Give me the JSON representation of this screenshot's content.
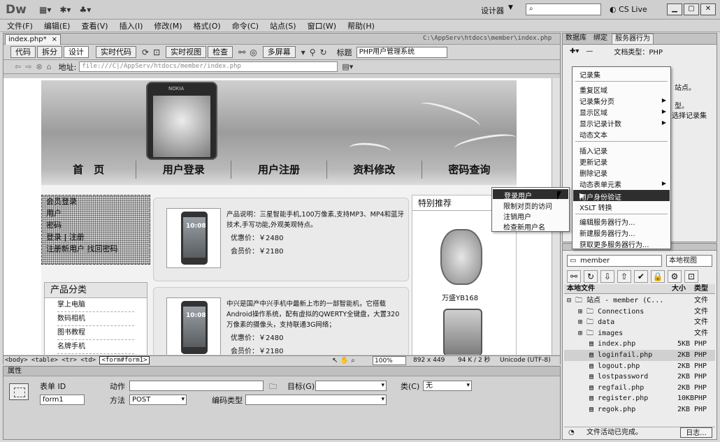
{
  "app": {
    "logo": "Dw",
    "workspace": "设计器",
    "cslive": "CS Live"
  },
  "menu": [
    "文件(F)",
    "编辑(E)",
    "查看(V)",
    "插入(I)",
    "修改(M)",
    "格式(O)",
    "命令(C)",
    "站点(S)",
    "窗口(W)",
    "帮助(H)"
  ],
  "doc": {
    "tab": "index.php*",
    "path": "C:\\AppServ\\htdocs\\member\\index.php",
    "views": [
      "代码",
      "拆分",
      "设计"
    ],
    "live_code": "实时代码",
    "live_view": "实时视图",
    "inspect": "检查",
    "multiscreen": "多屏幕",
    "title_label": "标题",
    "title_value": "PHP用户管理系统",
    "addr_label": "地址:",
    "addr_value": "file:///C|/AppServ/htdocs/member/index.php"
  },
  "page": {
    "phone_brand": "NOKIA",
    "nav": [
      "首　页",
      "用户登录",
      "用户注册",
      "资料修改",
      "密码查询"
    ],
    "left_dotted": [
      "会员登录",
      "用户",
      "密码",
      "登录 | 注册",
      "注册新用户 找回密码"
    ],
    "category_title": "产品分类",
    "categories": [
      "掌上电脑",
      "数码相机",
      "图书教程",
      "名牌手机"
    ],
    "products": [
      {
        "screen": "10:08",
        "text": "产品说明：三星智能手机,100万像素,支持MP3、MP4和蓝牙技术,手写功能,外观美观特点。",
        "price1": "优惠价：￥2480",
        "price2": "会员价：￥2180"
      },
      {
        "screen": "10:08",
        "text": "中兴是国产中兴手机中最新上市的一部智能机，它搭载Android操作系统，配有虚拟的QWERTY全键盘，大置320万像素的摄像头，支持联通3G网络；",
        "price1": "优惠价：￥2480",
        "price2": "会员价：￥2180"
      }
    ],
    "featured_title": "特别推荐",
    "featured_name": "万盛YB168"
  },
  "status": {
    "tags": "<body> <table> <tr> <td> ",
    "tag_selected": "<form#form1>",
    "zoom": "100%",
    "dims": "892 x 449",
    "size": "94 K / 2 秒",
    "encoding": "Unicode (UTF-8)"
  },
  "props": {
    "title": "属性",
    "form_id_label": "表单 ID",
    "form_id": "form1",
    "action_label": "动作",
    "method_label": "方法",
    "method_value": "POST",
    "enctype_label": "编码类型",
    "target_label": "目标(G)",
    "class_label": "类(C)",
    "class_value": "无"
  },
  "server_panel": {
    "tabs": [
      "数据库",
      "绑定",
      "服务器行为"
    ],
    "doctype": "文档类型：PHP",
    "bg_lines": [
      "站点。",
      "型。",
      "选择记录集"
    ]
  },
  "context_menu": {
    "items": [
      "记录集",
      "重复区域",
      "记录集分页",
      "显示区域",
      "显示记录计数",
      "动态文本",
      "插入记录",
      "更新记录",
      "删除记录",
      "动态表单元素",
      "用户身份验证",
      "XSLT 转换",
      "编辑服务器行为...",
      "新建服务器行为...",
      "获取更多服务器行为..."
    ]
  },
  "submenu": {
    "items": [
      "登录用户",
      "限制对页的访问",
      "注销用户",
      "检查新用户名"
    ]
  },
  "files": {
    "site": "member",
    "view": "本地视图",
    "col_name": "本地文件",
    "col_size": "大小",
    "col_type": "类型",
    "root": "站点 - member (C...",
    "root_type": "文件",
    "items": [
      {
        "name": "Connections",
        "size": "",
        "type": "文件"
      },
      {
        "name": "data",
        "size": "",
        "type": "文件"
      },
      {
        "name": "images",
        "size": "",
        "type": "文件"
      },
      {
        "name": "index.php",
        "size": "5KB",
        "type": "PHP"
      },
      {
        "name": "loginfail.php",
        "size": "2KB",
        "type": "PHP"
      },
      {
        "name": "logout.php",
        "size": "2KB",
        "type": "PHP"
      },
      {
        "name": "lostpassword",
        "size": "2KB",
        "type": "PHP"
      },
      {
        "name": "regfail.php",
        "size": "2KB",
        "type": "PHP"
      },
      {
        "name": "register.php",
        "size": "10KB",
        "type": "PHP"
      },
      {
        "name": "regok.php",
        "size": "2KB",
        "type": "PHP"
      }
    ],
    "status": "文件活动已完成。",
    "log": "日志..."
  }
}
